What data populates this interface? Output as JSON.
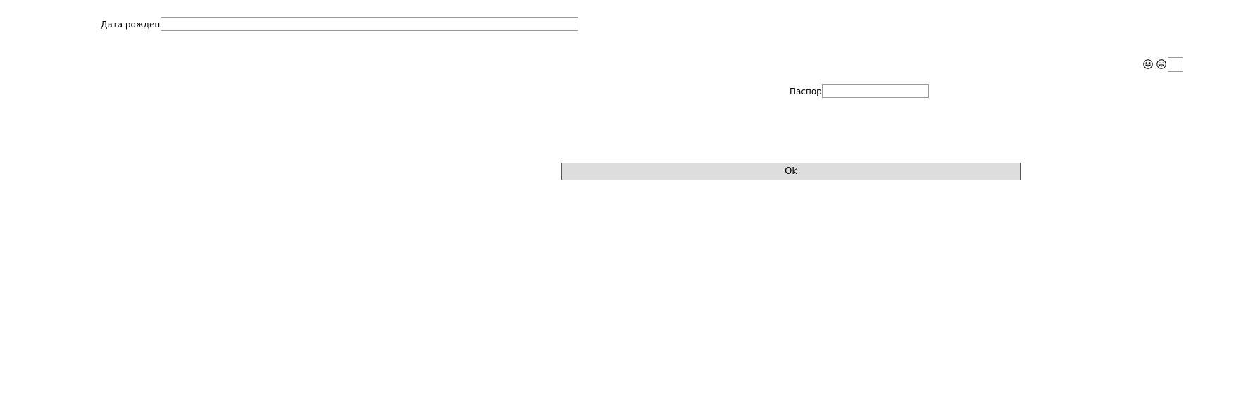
{
  "form": {
    "birth_date": {
      "label": "Дата рождения",
      "value": ""
    },
    "passport": {
      "label": "Паспорт",
      "value": ""
    },
    "small_box": {
      "value": ""
    },
    "icons": [
      "smiley-face-icon",
      "smiley-face-icon"
    ],
    "ok_button_label": "Ok"
  }
}
